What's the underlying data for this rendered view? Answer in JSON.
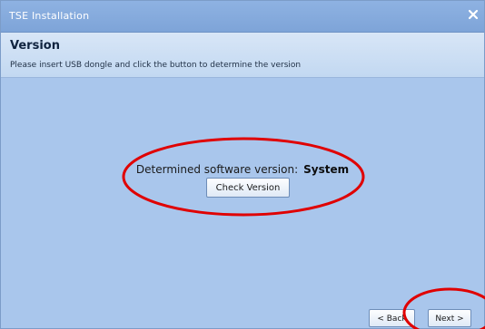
{
  "window": {
    "title": "TSE Installation",
    "close_icon": "close-icon"
  },
  "header": {
    "title": "Version",
    "description": "Please insert USB dongle and click the button to determine the version"
  },
  "main": {
    "version_label": "Determined software version:",
    "version_value": "System",
    "check_button_label": "Check Version"
  },
  "footer": {
    "back_label": "< Back",
    "next_label": "Next >"
  },
  "colors": {
    "window_bg": "#a9c6ec",
    "titlebar": "#7ea4d8",
    "annotation": "#e00000"
  }
}
